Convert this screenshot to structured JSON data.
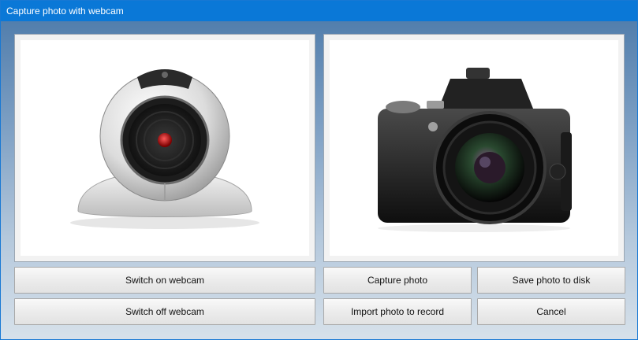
{
  "window": {
    "title": "Capture photo with webcam"
  },
  "buttons": {
    "switch_on": "Switch on webcam",
    "switch_off": "Switch off webcam",
    "capture": "Capture photo",
    "save": "Save photo to disk",
    "import": "Import photo to record",
    "cancel": "Cancel"
  },
  "images": {
    "left": "webcam-icon",
    "right": "camera-icon"
  },
  "colors": {
    "titlebar": "#0a78d7",
    "title_text": "#ffffff",
    "background_top": "#4a78a8",
    "background_bottom": "#d7e1ea"
  }
}
